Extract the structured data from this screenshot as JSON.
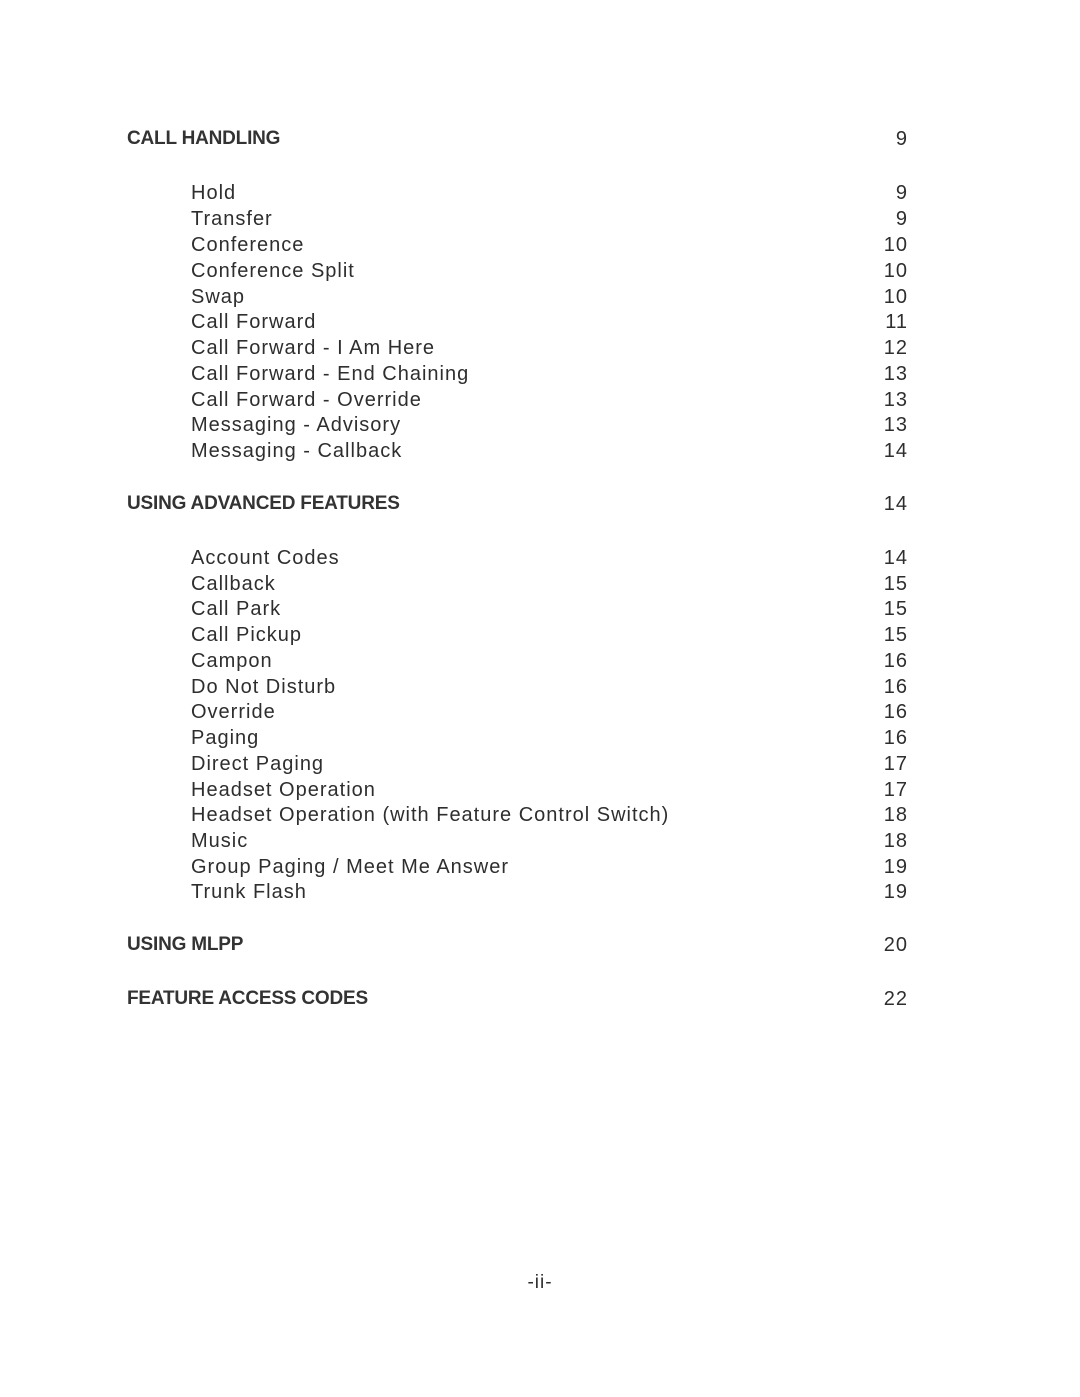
{
  "sections": [
    {
      "title": "CALL HANDLING",
      "page": "9",
      "entries": [
        {
          "title": "Hold",
          "page": "9"
        },
        {
          "title": "Transfer",
          "page": "9"
        },
        {
          "title": "Conference",
          "page": "10"
        },
        {
          "title": "Conference Split",
          "page": "10"
        },
        {
          "title": "Swap",
          "page": "10"
        },
        {
          "title": "Call Forward",
          "page": "11"
        },
        {
          "title": "Call Forward - I Am Here",
          "page": "12"
        },
        {
          "title": "Call Forward - End Chaining",
          "page": "13"
        },
        {
          "title": "Call Forward - Override",
          "page": "13"
        },
        {
          "title": "Messaging - Advisory",
          "page": "13"
        },
        {
          "title": "Messaging - Callback",
          "page": "14"
        }
      ]
    },
    {
      "title": "USING ADVANCED FEATURES",
      "page": "14",
      "entries": [
        {
          "title": "Account Codes",
          "page": "14"
        },
        {
          "title": "Callback",
          "page": "15"
        },
        {
          "title": "Call Park",
          "page": "15"
        },
        {
          "title": "Call Pickup",
          "page": "15"
        },
        {
          "title": "Campon",
          "page": "16"
        },
        {
          "title": "Do Not Disturb",
          "page": "16"
        },
        {
          "title": "Override",
          "page": "16"
        },
        {
          "title": "Paging",
          "page": "16"
        },
        {
          "title": "Direct Paging",
          "page": "17"
        },
        {
          "title": "Headset Operation",
          "page": "17"
        },
        {
          "title": "Headset Operation (with Feature Control Switch)",
          "page": "18"
        },
        {
          "title": "Music",
          "page": "18"
        },
        {
          "title": "Group Paging / Meet Me Answer",
          "page": "19"
        },
        {
          "title": "Trunk Flash",
          "page": "19"
        }
      ]
    },
    {
      "title": "USING MLPP",
      "page": "20",
      "entries": []
    },
    {
      "title": "FEATURE ACCESS CODES",
      "page": "22",
      "entries": []
    }
  ],
  "footer": {
    "page_label": "-ii-"
  }
}
